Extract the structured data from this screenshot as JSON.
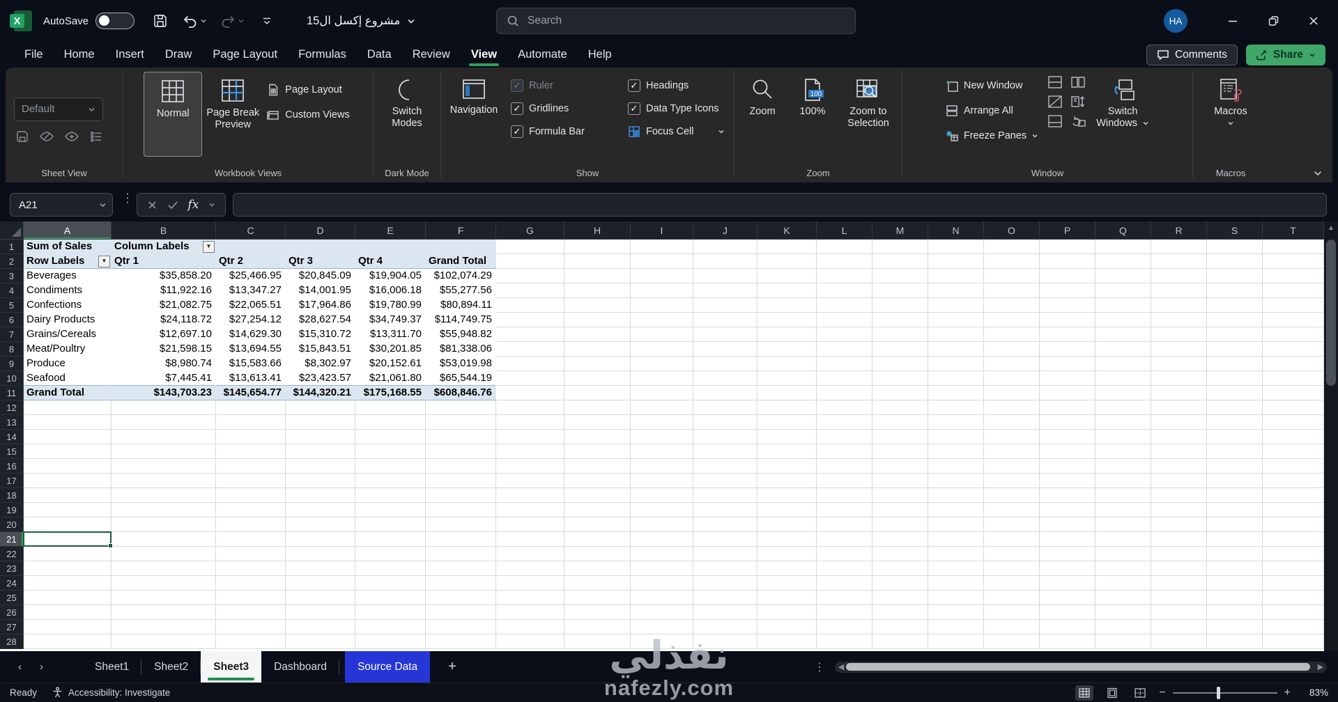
{
  "titlebar": {
    "autosave": "AutoSave",
    "autosave_state": "off",
    "filename": "مشروع إكسل ال15",
    "search_placeholder": "Search",
    "avatar_initials": "HA"
  },
  "ribbon": {
    "tabs": [
      "File",
      "Home",
      "Insert",
      "Draw",
      "Page Layout",
      "Formulas",
      "Data",
      "Review",
      "View",
      "Automate",
      "Help"
    ],
    "active_tab": "View",
    "comments_label": "Comments",
    "share_label": "Share",
    "groups": {
      "sheet_view": {
        "label": "Sheet View",
        "default_option": "Default"
      },
      "workbook_views": {
        "label": "Workbook Views",
        "items": [
          "Normal",
          "Page Break Preview",
          "Page Layout",
          "Custom Views"
        ],
        "selected": "Normal"
      },
      "dark_mode": {
        "label": "Dark Mode",
        "switch_modes": "Switch Modes"
      },
      "show": {
        "label": "Show",
        "navigation": "Navigation",
        "checks_left": [
          {
            "label": "Ruler",
            "checked": true,
            "disabled": true
          },
          {
            "label": "Gridlines",
            "checked": true,
            "disabled": false
          },
          {
            "label": "Formula Bar",
            "checked": true,
            "disabled": false
          }
        ],
        "checks_right": [
          {
            "label": "Headings",
            "checked": true,
            "disabled": false
          },
          {
            "label": "Data Type Icons",
            "checked": true,
            "disabled": false
          }
        ],
        "focus_cell": "Focus Cell"
      },
      "zoom": {
        "label": "Zoom",
        "items": [
          "Zoom",
          "100%",
          "Zoom to Selection"
        ],
        "badge": "100"
      },
      "window": {
        "label": "Window",
        "items": [
          "New Window",
          "Arrange All",
          "Freeze Panes"
        ],
        "switch_windows": "Switch Windows"
      },
      "macros": {
        "label": "Macros",
        "button": "Macros"
      }
    }
  },
  "formula_bar": {
    "name_box": "A21"
  },
  "grid": {
    "columns": [
      "A",
      "B",
      "C",
      "D",
      "E",
      "F",
      "G",
      "H",
      "I",
      "J",
      "K",
      "L",
      "M",
      "N",
      "O",
      "P",
      "Q",
      "R",
      "S",
      "T"
    ],
    "row_count": 28,
    "selected_column": "A",
    "selected_row": 21
  },
  "pivot": {
    "title_cell": "Sum of Sales",
    "column_labels_cell": "Column Labels",
    "row_labels_cell": "Row Labels",
    "quarter_headers": [
      "Qtr 1",
      "Qtr 2",
      "Qtr 3",
      "Qtr 4",
      "Grand Total"
    ],
    "rows": [
      {
        "label": "Beverages",
        "values": [
          "$35,858.20",
          "$25,466.95",
          "$20,845.09",
          "$19,904.05",
          "$102,074.29"
        ]
      },
      {
        "label": "Condiments",
        "values": [
          "$11,922.16",
          "$13,347.27",
          "$14,001.95",
          "$16,006.18",
          "$55,277.56"
        ]
      },
      {
        "label": "Confections",
        "values": [
          "$21,082.75",
          "$22,065.51",
          "$17,964.86",
          "$19,780.99",
          "$80,894.11"
        ]
      },
      {
        "label": "Dairy Products",
        "values": [
          "$24,118.72",
          "$27,254.12",
          "$28,627.54",
          "$34,749.37",
          "$114,749.75"
        ]
      },
      {
        "label": "Grains/Cereals",
        "values": [
          "$12,697.10",
          "$14,629.30",
          "$15,310.72",
          "$13,311.70",
          "$55,948.82"
        ]
      },
      {
        "label": "Meat/Poultry",
        "values": [
          "$21,598.15",
          "$13,694.55",
          "$15,843.51",
          "$30,201.85",
          "$81,338.06"
        ]
      },
      {
        "label": "Produce",
        "values": [
          "$8,980.74",
          "$15,583.66",
          "$8,302.97",
          "$20,152.61",
          "$53,019.98"
        ]
      },
      {
        "label": "Seafood",
        "values": [
          "$7,445.41",
          "$13,613.41",
          "$23,423.57",
          "$21,061.80",
          "$65,544.19"
        ]
      }
    ],
    "grand_total": {
      "label": "Grand Total",
      "values": [
        "$143,703.23",
        "$145,654.77",
        "$144,320.21",
        "$175,168.55",
        "$608,846.76"
      ]
    }
  },
  "sheet_tabs": {
    "tabs": [
      "Sheet1",
      "Sheet2",
      "Sheet3",
      "Dashboard",
      "Source Data"
    ],
    "active": "Sheet3",
    "accent": "Source Data"
  },
  "status_bar": {
    "ready": "Ready",
    "accessibility": "Accessibility: Investigate",
    "zoom_level": "83%"
  },
  "watermark": {
    "line1": "نفذلي",
    "line2": "nafezly.com"
  },
  "colors": {
    "accent_green": "#2e9e5b",
    "sheet_tab_blue": "#2636d6",
    "pivot_fill": "#dce6f1",
    "pivot_border": "#95b3d7",
    "avatar_blue": "#155a9c"
  }
}
